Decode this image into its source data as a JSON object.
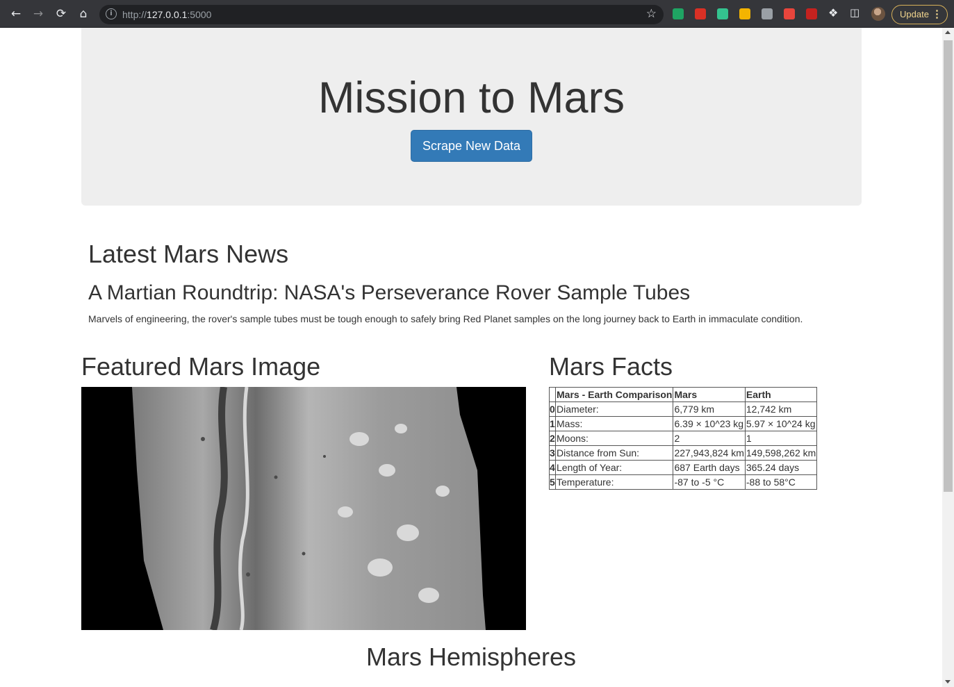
{
  "browser": {
    "url_scheme": "http://",
    "url_host": "127.0.0.1",
    "url_port": ":5000",
    "update_label": "Update",
    "extensions": [
      {
        "name": "google-drive-icon",
        "color": "#1fa463"
      },
      {
        "name": "extension-red-icon",
        "color": "#d93025"
      },
      {
        "name": "notion-n-icon",
        "color": "#34c38f"
      },
      {
        "name": "google-drive-alt-icon",
        "color": "#f4b400"
      },
      {
        "name": "extension-gray-icon",
        "color": "#9aa0a6"
      },
      {
        "name": "shield-extension-icon",
        "color": "#e8453c"
      },
      {
        "name": "b-extension-icon",
        "color": "#c5221f"
      }
    ]
  },
  "jumbotron": {
    "title": "Mission to Mars",
    "button_label": "Scrape New Data",
    "button_color": "#337ab7"
  },
  "news": {
    "heading": "Latest Mars News",
    "title": "A Martian Roundtrip: NASA's Perseverance Rover Sample Tubes",
    "body": "Marvels of engineering, the rover's sample tubes must be tough enough to safely bring Red Planet samples on the long journey back to Earth in immaculate condition."
  },
  "featured": {
    "heading": "Featured Mars Image"
  },
  "facts": {
    "heading": "Mars Facts",
    "columns": [
      "Mars - Earth Comparison",
      "Mars",
      "Earth"
    ],
    "rows": [
      {
        "index": "0",
        "label": "Diameter:",
        "mars": "6,779 km",
        "earth": "12,742 km"
      },
      {
        "index": "1",
        "label": "Mass:",
        "mars": "6.39 × 10^23 kg",
        "earth": "5.97 × 10^24 kg"
      },
      {
        "index": "2",
        "label": "Moons:",
        "mars": "2",
        "earth": "1"
      },
      {
        "index": "3",
        "label": "Distance from Sun:",
        "mars": "227,943,824 km",
        "earth": "149,598,262 km"
      },
      {
        "index": "4",
        "label": "Length of Year:",
        "mars": "687 Earth days",
        "earth": "365.24 days"
      },
      {
        "index": "5",
        "label": "Temperature:",
        "mars": "-87 to -5 °C",
        "earth": "-88 to 58°C"
      }
    ]
  },
  "hemispheres": {
    "heading": "Mars Hemispheres"
  }
}
